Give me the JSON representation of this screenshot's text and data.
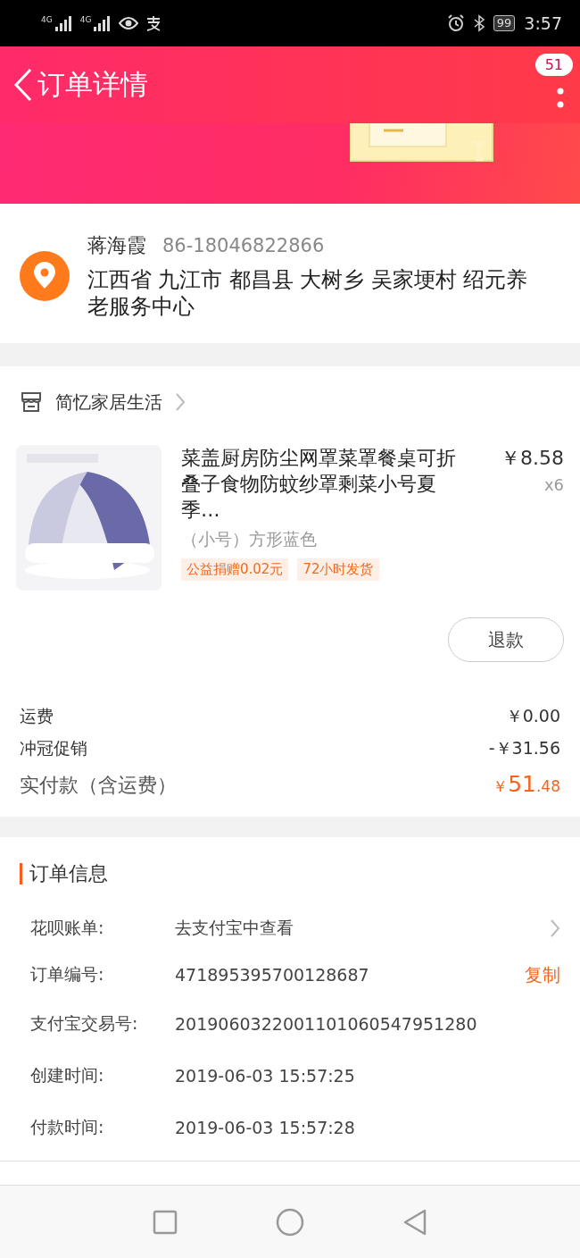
{
  "status_bar": {
    "networks": [
      "4G",
      "4G"
    ],
    "battery": "99",
    "time": "3:57"
  },
  "header": {
    "title": "订单详情",
    "badge": "51"
  },
  "address": {
    "name": "蒋海霞",
    "phone": "86-18046822866",
    "address": "江西省 九江市 都昌县 大树乡 吴家埂村 绍元养老服务中心"
  },
  "shop": {
    "name": "简忆家居生活"
  },
  "product": {
    "title": "菜盖厨房防尘网罩菜罩餐桌可折叠子食物防蚊纱罩剩菜小号夏季…",
    "price": "￥8.58",
    "quantity": "x6",
    "variant": "（小号）方形蓝色",
    "tags": [
      "公益捐赠0.02元",
      "72小时发货"
    ]
  },
  "refund_button": "退款",
  "costs": [
    {
      "label": "运费",
      "value": "￥0.00"
    },
    {
      "label": "冲冠促销",
      "value": "-￥31.56"
    }
  ],
  "total": {
    "label": "实付款（含运费）",
    "currency": "￥",
    "integer": "51",
    "decimal": ".48"
  },
  "order_info": {
    "title": "订单信息",
    "rows": [
      {
        "kind": "link",
        "label": "花呗账单:",
        "value": "去支付宝中查看"
      },
      {
        "kind": "copy",
        "label": "订单编号:",
        "value": "471895395700128687",
        "action": "复制"
      },
      {
        "kind": "text",
        "label": "支付宝交易号:",
        "value": "2019060322001101060547951280"
      },
      {
        "kind": "text",
        "label": "创建时间:",
        "value": "2019-06-03 15:57:25"
      },
      {
        "kind": "text",
        "label": "付款时间:",
        "value": "2019-06-03 15:57:28"
      }
    ]
  }
}
